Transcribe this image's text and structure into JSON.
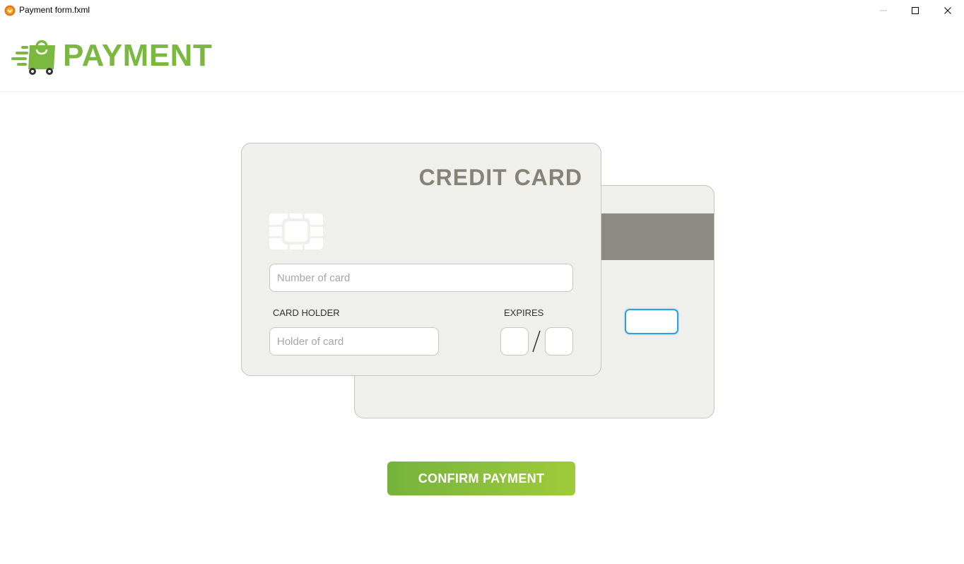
{
  "window": {
    "title": "Payment form.fxml",
    "icon": "app-icon",
    "controls": [
      "minimize-icon",
      "maximize-icon",
      "close-icon"
    ]
  },
  "header": {
    "logo_icon": "shopping-bag-cart-icon",
    "logo_text": "PAYMENT",
    "brand_color": "#7ab840"
  },
  "card_front": {
    "title": "CREDIT CARD",
    "chip_icon": "chip-icon",
    "number": {
      "value": "",
      "placeholder": "Number of card"
    },
    "holder_label": "CARD HOLDER",
    "holder": {
      "value": "",
      "placeholder": "Holder of card"
    },
    "expires_label": "EXPIRES",
    "expires_month": {
      "value": ""
    },
    "expires_year": {
      "value": ""
    }
  },
  "card_back": {
    "cvv": {
      "value": "",
      "focused": true
    }
  },
  "confirm_button": {
    "label": "CONFIRM PAYMENT",
    "gradient_start": "#76b33d",
    "gradient_end": "#9fcb3a"
  }
}
